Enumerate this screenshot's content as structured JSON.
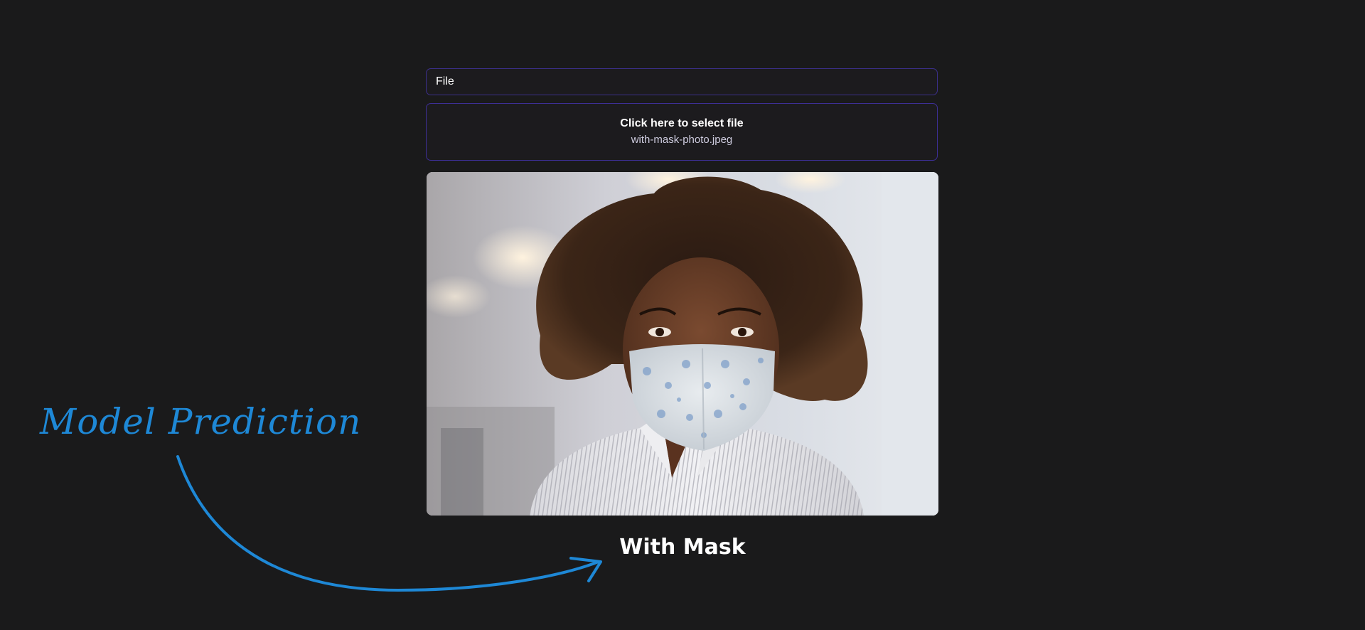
{
  "file_field": {
    "label": "File"
  },
  "dropzone": {
    "title": "Click here to select file",
    "filename": "with-mask-photo.jpeg"
  },
  "preview": {
    "icon": "uploaded-photo"
  },
  "prediction": {
    "label": "With Mask"
  },
  "annotation": {
    "text": "Model Prediction",
    "color": "#1e88d6"
  },
  "colors": {
    "background": "#1a1a1b",
    "border_accent": "#3d2f96"
  }
}
